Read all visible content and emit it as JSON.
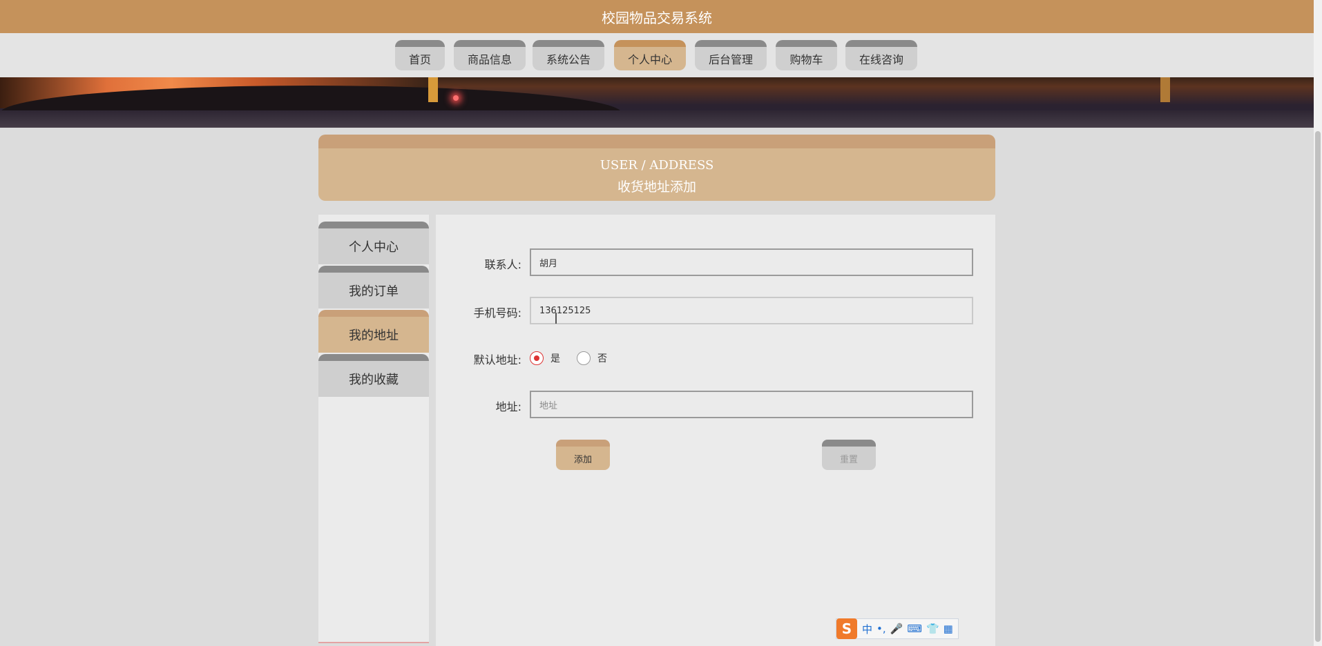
{
  "app": {
    "title": "校园物品交易系统"
  },
  "nav": {
    "items": [
      {
        "label": "首页",
        "active": false
      },
      {
        "label": "商品信息",
        "active": false
      },
      {
        "label": "系统公告",
        "active": false
      },
      {
        "label": "个人中心",
        "active": true
      },
      {
        "label": "后台管理",
        "active": false
      },
      {
        "label": "购物车",
        "active": false
      },
      {
        "label": "在线咨询",
        "active": false
      }
    ]
  },
  "header": {
    "en": "USER / ADDRESS",
    "cn": "收货地址添加"
  },
  "sidebar": {
    "items": [
      {
        "label": "个人中心",
        "active": false
      },
      {
        "label": "我的订单",
        "active": false
      },
      {
        "label": "我的地址",
        "active": true
      },
      {
        "label": "我的收藏",
        "active": false
      }
    ]
  },
  "form": {
    "contact_label": "联系人:",
    "contact_value": "胡月",
    "phone_label": "手机号码:",
    "phone_value": "136125125",
    "default_label": "默认地址:",
    "default_yes": "是",
    "default_no": "否",
    "default_selected": "是",
    "address_label": "地址:",
    "address_placeholder": "地址",
    "add_button": "添加",
    "reset_button": "重置"
  },
  "ime": {
    "mode": "中",
    "punct": "•,",
    "logo": "S"
  },
  "colors": {
    "brand": "#c5925b",
    "accent": "#d5b68f",
    "tab_top": "#8a8a8a",
    "radio_checked": "#dd3333"
  }
}
